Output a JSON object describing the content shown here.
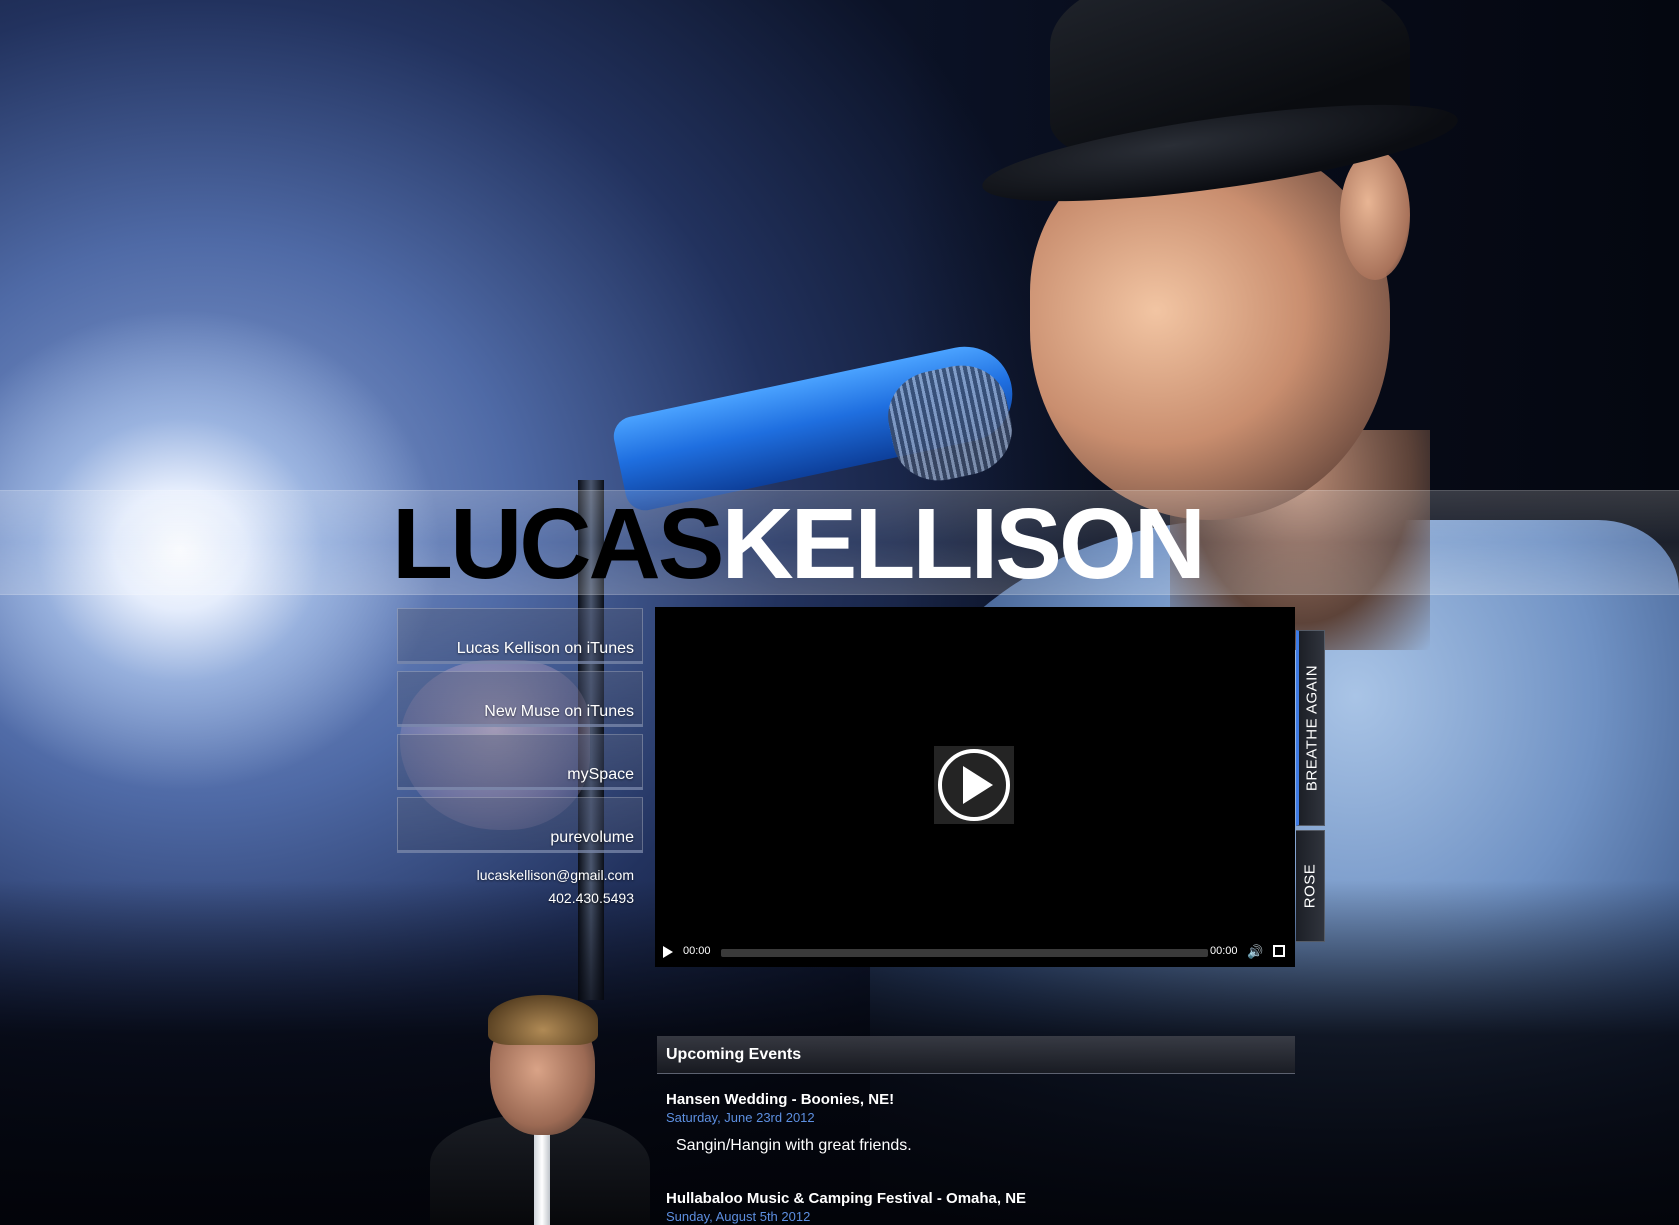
{
  "header": {
    "first_name": "LUCAS",
    "last_name": "KELLISON"
  },
  "links": [
    {
      "label": "Lucas Kellison on iTunes"
    },
    {
      "label": "New Muse on iTunes"
    },
    {
      "label": "mySpace"
    },
    {
      "label": "purevolume"
    }
  ],
  "contact": {
    "email": "lucaskellison@gmail.com",
    "phone": "402.430.5493"
  },
  "player": {
    "current_time": "00:00",
    "duration": "00:00",
    "play_icon": "play-icon",
    "volume_icon": "volume-icon",
    "fullscreen_icon": "fullscreen-icon"
  },
  "tabs": [
    {
      "label": "BREATHE AGAIN",
      "active": true
    },
    {
      "label": "ROSE",
      "active": false
    }
  ],
  "events": {
    "heading": "Upcoming Events",
    "items": [
      {
        "name": "Hansen Wedding - Boonies, NE!",
        "date": "Saturday, June 23rd 2012",
        "description": "Sangin/Hangin with great friends."
      },
      {
        "name": "Hullabaloo Music & Camping Festival - Omaha, NE",
        "date": "Sunday, August 5th 2012",
        "description": ""
      }
    ]
  },
  "colors": {
    "accent": "#3e7be6",
    "event_date": "#5d8fe0"
  }
}
